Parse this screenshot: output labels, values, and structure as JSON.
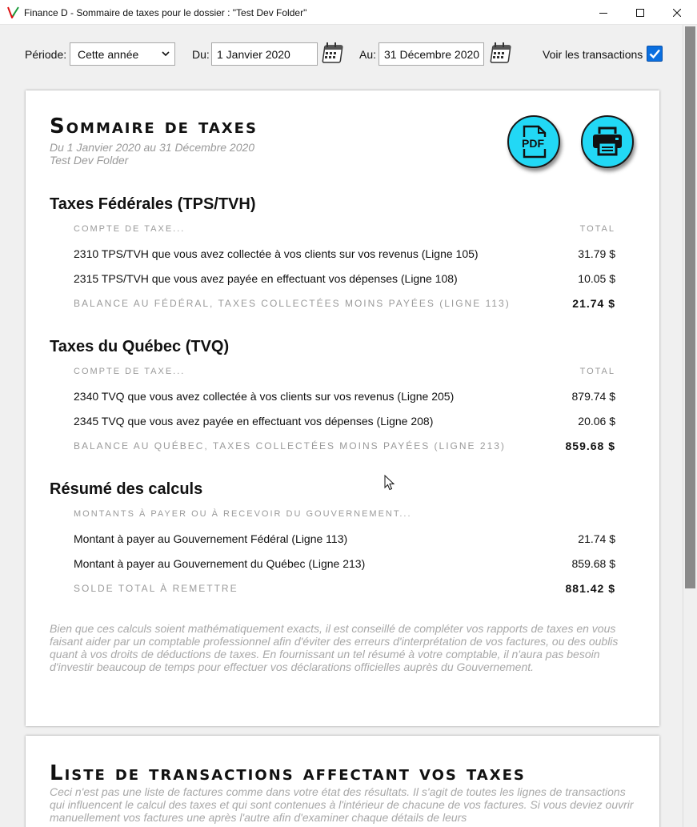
{
  "window": {
    "title": "Finance D - Sommaire de taxes pour le dossier : \"Test Dev Folder\""
  },
  "toolbar": {
    "period_label": "Période:",
    "period_value": "Cette année",
    "from_label": "Du:",
    "from_value": "1 Janvier 2020",
    "to_label": "Au:",
    "to_value": "31 Décembre 2020",
    "show_transactions_label": "Voir les transactions",
    "show_transactions_checked": true
  },
  "summary": {
    "title": "Sommaire de taxes",
    "date_range": "Du 1 Janvier 2020 au 31 Décembre 2020",
    "folder": "Test Dev Folder",
    "pdf_label": "PDF",
    "federal": {
      "heading": "Taxes Fédérales (TPS/TVH)",
      "col_account": "Compte de taxe...",
      "col_total": "Total",
      "rows": [
        {
          "label": "2310 TPS/TVH que vous avez collectée à vos clients sur vos revenus (Ligne 105)",
          "amount": "31.79 $"
        },
        {
          "label": "2315 TPS/TVH que vous avez payée en effectuant vos dépenses (Ligne 108)",
          "amount": "10.05 $"
        }
      ],
      "balance_label": "Balance au fédéral, taxes collectées moins payées (ligne 113)",
      "balance_amount": "21.74 $"
    },
    "quebec": {
      "heading": "Taxes du Québec (TVQ)",
      "col_account": "Compte de taxe...",
      "col_total": "Total",
      "rows": [
        {
          "label": "2340 TVQ que vous avez collectée à vos clients sur vos revenus (Ligne 205)",
          "amount": "879.74 $"
        },
        {
          "label": "2345 TVQ que vous avez payée en effectuant vos dépenses (Ligne 208)",
          "amount": "20.06 $"
        }
      ],
      "balance_label": "Balance au Québec, taxes collectées moins payées (ligne 213)",
      "balance_amount": "859.68 $"
    },
    "calc": {
      "heading": "Résumé des calculs",
      "col_header": "Montants à payer ou à recevoir du gouvernement...",
      "rows": [
        {
          "label": "Montant à payer au Gouvernement Fédéral (Ligne 113)",
          "amount": "21.74 $"
        },
        {
          "label": "Montant à payer au Gouvernement du Québec (Ligne 213)",
          "amount": "859.68 $"
        }
      ],
      "total_label": "Solde total à remettre",
      "total_amount": "881.42 $"
    },
    "disclaimer": "Bien que ces calculs soient mathématiquement exacts, il est conseillé de compléter vos rapports de taxes en vous faisant aider par un comptable professionnel afin d'éviter des erreurs d'interprétation de vos factures, ou des oublis quant à vos droits de déductions de taxes. En fournissant un tel résumé à votre comptable, il n'aura pas besoin d'investir beaucoup de temps pour effectuer vos déclarations officielles auprès du Gouvernement."
  },
  "transactions": {
    "title": "Liste de transactions affectant vos taxes",
    "note": "Ceci n'est pas une liste de factures comme dans votre état des résultats. Il s'agit de toutes les lignes de transactions qui influencent le calcul des taxes et qui sont contenues à l'intérieur de chacune de vos factures. Si vous deviez ouvrir manuellement vos factures une après l'autre afin d'examiner chaque détails de leurs"
  },
  "icons": {
    "app": "finance-d-logo-icon",
    "calendar": "calendar-icon",
    "pdf": "pdf-icon",
    "print": "printer-icon",
    "check": "checkmark-icon",
    "cursor": "mouse-cursor-icon"
  },
  "colors": {
    "accent_button": "#22d8f5",
    "checkbox": "#0a6fe0",
    "muted_text": "#9a9a9a"
  }
}
